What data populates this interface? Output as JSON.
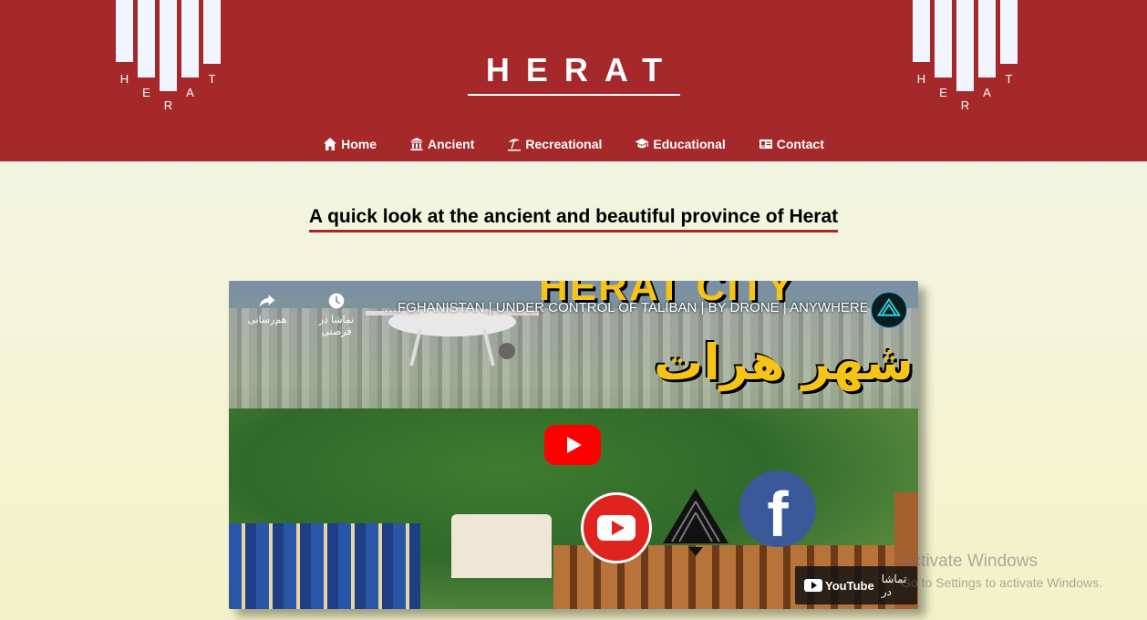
{
  "header": {
    "title": "HERAT",
    "logo_letters": [
      "H",
      "E",
      "R",
      "A",
      "T"
    ],
    "colors": {
      "brand": "#a5282a",
      "bars": "#f1f5ff"
    }
  },
  "nav": {
    "items": [
      {
        "label": "Home",
        "icon": "home-icon"
      },
      {
        "label": "Ancient",
        "icon": "museum-icon"
      },
      {
        "label": "Recreational",
        "icon": "umbrella-beach-icon"
      },
      {
        "label": "Educational",
        "icon": "graduation-cap-icon"
      },
      {
        "label": "Contact",
        "icon": "address-card-icon"
      }
    ]
  },
  "main": {
    "heading": "A quick look at the ancient and beautiful province of Herat"
  },
  "video": {
    "title": "…FGHANISTAN | UNDER CONTROL OF TALIBAN | BY DRONE | ANYWHERE",
    "share_label": "هم‌رسانی",
    "watch_later_label": "تماشا در فرصتی",
    "banner_text": "HERAT CITY",
    "arabic_text": "شهر هرات",
    "fb_letter": "f",
    "watch_on_label": "تماشا در",
    "youtube_label": "YouTube"
  },
  "os_overlay": {
    "line1": "Activate Windows",
    "line2": "Go to Settings to activate Windows."
  }
}
